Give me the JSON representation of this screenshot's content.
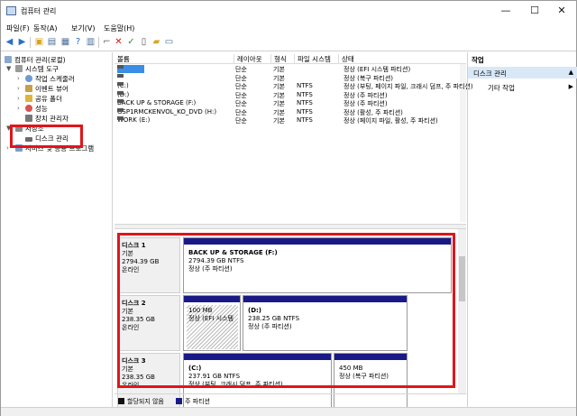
{
  "window": {
    "title": "컴퓨터 관리",
    "minimize": "—",
    "maximize": "☐",
    "close": "✕"
  },
  "menu": [
    "파일(F)",
    "동작(A)",
    "보기(V)",
    "도움말(H)"
  ],
  "tree": {
    "root": "컴퓨터 관리(로컬)",
    "system_tools": "시스템 도구",
    "task_scheduler": "작업 스케줄러",
    "event_viewer": "이벤트 뷰어",
    "shared_folders": "공유 폴더",
    "performance": "성능",
    "device_manager": "장치 관리자",
    "storage": "저장소",
    "disk_management": "디스크 관리",
    "services_apps": "서비스 및 응용 프로그램"
  },
  "volume_headers": [
    "볼륨",
    "레이아웃",
    "형식",
    "파일 시스템",
    "상태"
  ],
  "volumes": [
    {
      "name": "",
      "layout": "단순",
      "type": "기본",
      "fs": "",
      "status": "정상 (EFI 시스템 파티션)",
      "selected": true
    },
    {
      "name": "",
      "layout": "단순",
      "type": "기본",
      "fs": "",
      "status": "정상 (복구 파티션)",
      "selected": false
    },
    {
      "name": "(C:)",
      "layout": "단순",
      "type": "기본",
      "fs": "NTFS",
      "status": "정상 (부팅, 페이지 파일, 크래시 덤프, 주 파티션)",
      "selected": false
    },
    {
      "name": "(D:)",
      "layout": "단순",
      "type": "기본",
      "fs": "NTFS",
      "status": "정상 (주 파티션)",
      "selected": false
    },
    {
      "name": "BACK UP & STORAGE (F:)",
      "layout": "단순",
      "type": "기본",
      "fs": "NTFS",
      "status": "정상 (주 파티션)",
      "selected": false
    },
    {
      "name": "GSP1RMCKENVOL_KO_DVD (H:)",
      "layout": "단순",
      "type": "기본",
      "fs": "NTFS",
      "status": "정상 (활성, 주 파티션)",
      "selected": false
    },
    {
      "name": "WORK (E:)",
      "layout": "단순",
      "type": "기본",
      "fs": "NTFS",
      "status": "정상 (페이지 파일, 활성, 주 파티션)",
      "selected": false
    }
  ],
  "disks": [
    {
      "name": "디스크 1",
      "kind": "기본",
      "size": "2794.39 GB",
      "state": "온라인",
      "parts": [
        {
          "title": "BACK UP & STORAGE  (F:)",
          "size": "2794.39 GB NTFS",
          "status": "정상 (주 파티션)"
        }
      ]
    },
    {
      "name": "디스크 2",
      "kind": "기본",
      "size": "238.35 GB",
      "state": "온라인",
      "parts": [
        {
          "title": "",
          "size": "100 MB",
          "status": "정상 (EFI 시스템"
        },
        {
          "title": "(D:)",
          "size": "238.25 GB NTFS",
          "status": "정상 (주 파티션)"
        }
      ]
    },
    {
      "name": "디스크 3",
      "kind": "기본",
      "size": "238.35 GB",
      "state": "온라인",
      "parts": [
        {
          "title": "(C:)",
          "size": "237.91 GB NTFS",
          "status": "정상 (부팅, 크래시 덤프, 주 파티션)"
        },
        {
          "title": "",
          "size": "450 MB",
          "status": "정상 (복구 파티션)"
        }
      ]
    }
  ],
  "legend": {
    "unallocated": "할당되지 않음",
    "primary": "주 파티션"
  },
  "actions": {
    "header": "작업",
    "section": "디스크 관리",
    "more": "기타 작업"
  },
  "colors": {
    "highlight": "#e0151b",
    "partition_bar": "#1a1a86",
    "selection": "#3a8ee6"
  }
}
